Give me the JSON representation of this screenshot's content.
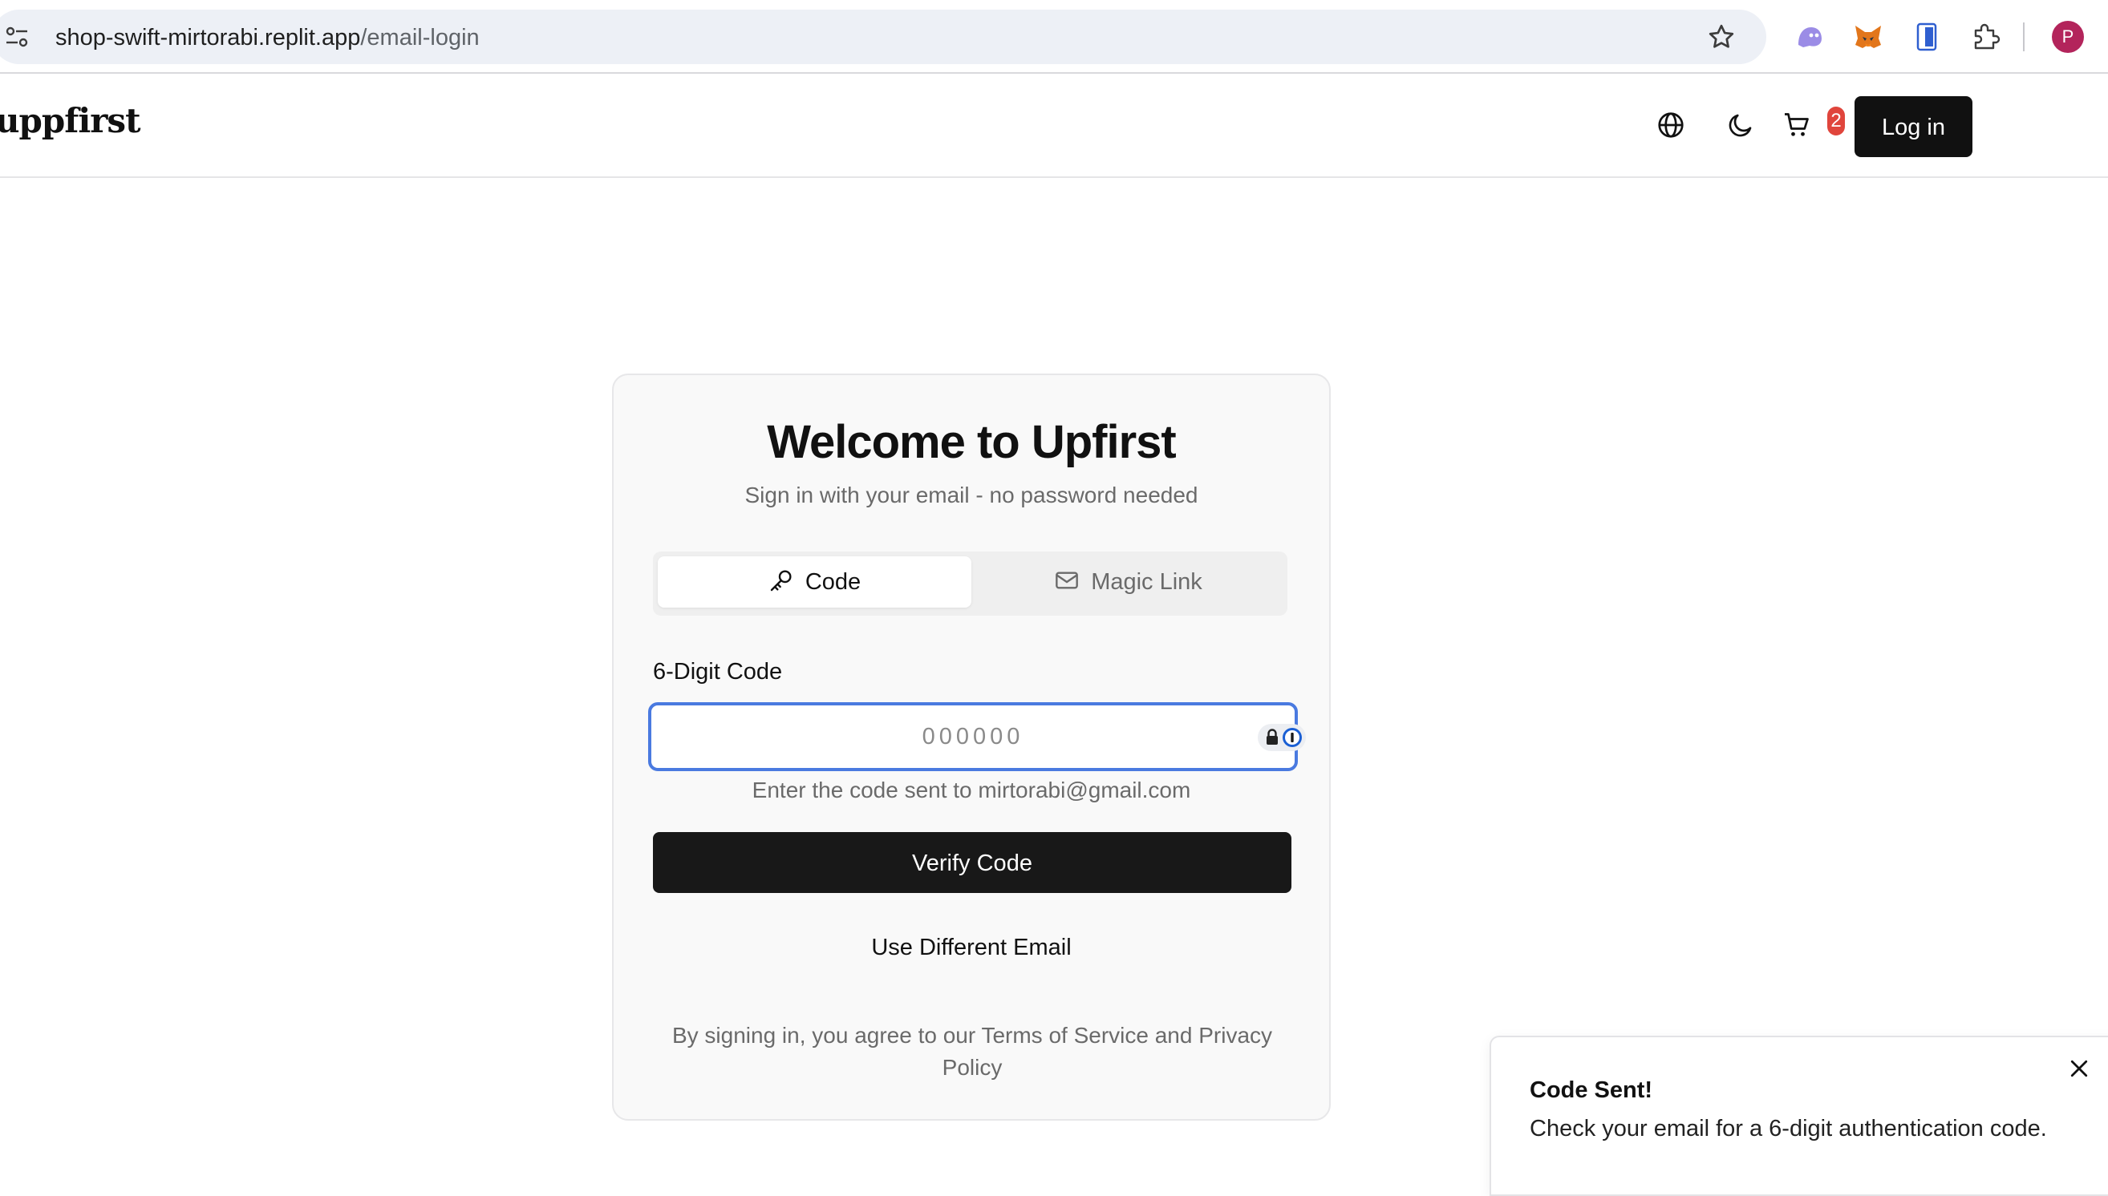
{
  "browser": {
    "url_host": "shop-swift-mirtorabi.replit.app",
    "url_path": "/email-login",
    "profile_initial": "P"
  },
  "header": {
    "logo": "uppfirst",
    "cart_count": "2",
    "login_label": "Log in"
  },
  "card": {
    "title": "Welcome to Upfirst",
    "subtitle": "Sign in with your email - no password needed",
    "tabs": [
      {
        "label": "Code",
        "icon": "key-icon",
        "active": true
      },
      {
        "label": "Magic Link",
        "icon": "mail-icon",
        "active": false
      }
    ],
    "code_label": "6-Digit Code",
    "code_placeholder": "000000",
    "code_value": "",
    "hint": "Enter the code sent to mirtorabi@gmail.com",
    "verify_label": "Verify Code",
    "different_email_label": "Use Different Email",
    "terms": "By signing in, you agree to our Terms of Service and Privacy Policy"
  },
  "toast": {
    "title": "Code Sent!",
    "message": "Check your email for a 6-digit authentication code."
  },
  "colors": {
    "focus_ring": "#4a7ae0",
    "primary_button": "#181818",
    "badge": "#e0453c",
    "profile": "#b3245b"
  }
}
